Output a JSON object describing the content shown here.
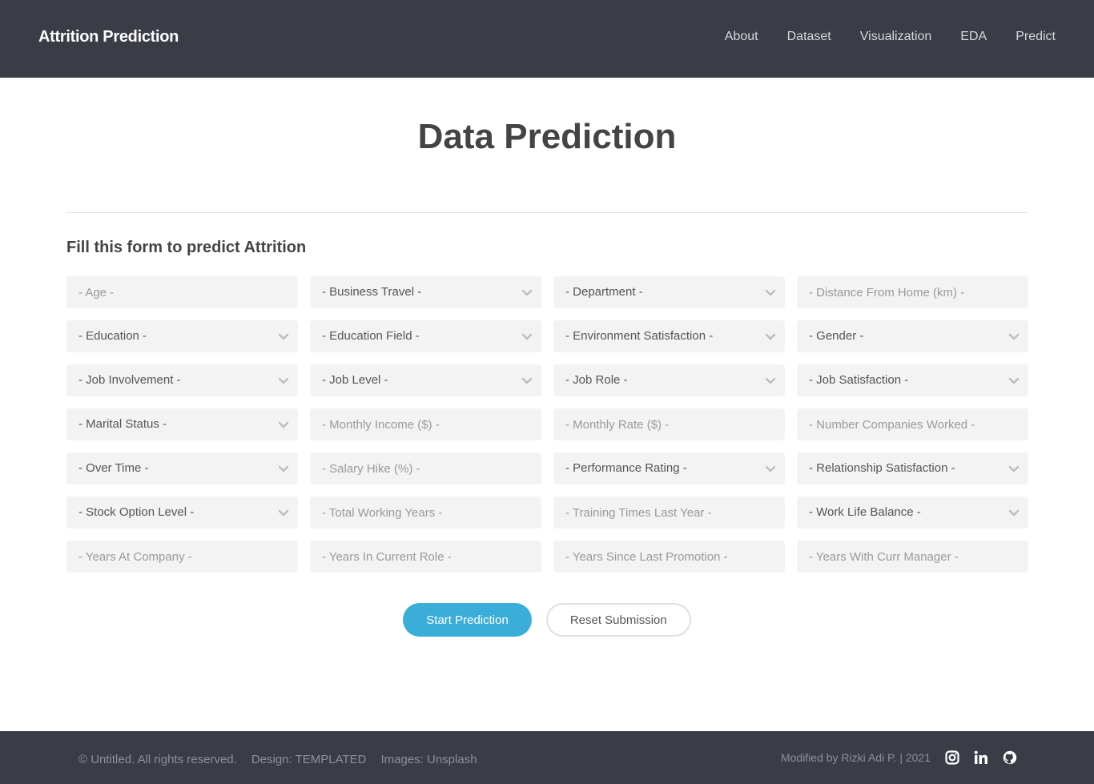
{
  "header": {
    "brand": "Attrition Prediction",
    "nav": [
      "About",
      "Dataset",
      "Visualization",
      "EDA",
      "Predict"
    ]
  },
  "main": {
    "title": "Data Prediction",
    "form_heading": "Fill this form to predict Attrition",
    "fields": [
      {
        "label": "- Age -",
        "kind": "input"
      },
      {
        "label": "- Business Travel -",
        "kind": "select"
      },
      {
        "label": "- Department -",
        "kind": "select"
      },
      {
        "label": "- Distance From Home (km) -",
        "kind": "input"
      },
      {
        "label": "- Education -",
        "kind": "select"
      },
      {
        "label": "- Education Field -",
        "kind": "select"
      },
      {
        "label": "- Environment Satisfaction -",
        "kind": "select"
      },
      {
        "label": "- Gender -",
        "kind": "select"
      },
      {
        "label": "- Job Involvement -",
        "kind": "select"
      },
      {
        "label": "- Job Level -",
        "kind": "select"
      },
      {
        "label": "- Job Role -",
        "kind": "select"
      },
      {
        "label": "- Job Satisfaction -",
        "kind": "select"
      },
      {
        "label": "- Marital Status -",
        "kind": "select"
      },
      {
        "label": "- Monthly Income ($) -",
        "kind": "input"
      },
      {
        "label": "- Monthly Rate ($) -",
        "kind": "input"
      },
      {
        "label": "- Number Companies Worked -",
        "kind": "input"
      },
      {
        "label": "- Over Time -",
        "kind": "select"
      },
      {
        "label": "- Salary Hike (%) -",
        "kind": "input"
      },
      {
        "label": "- Performance Rating -",
        "kind": "select"
      },
      {
        "label": "- Relationship Satisfaction -",
        "kind": "select"
      },
      {
        "label": "- Stock Option Level -",
        "kind": "select"
      },
      {
        "label": "- Total Working Years -",
        "kind": "input"
      },
      {
        "label": "- Training Times Last Year -",
        "kind": "input"
      },
      {
        "label": "- Work Life Balance -",
        "kind": "select"
      },
      {
        "label": "- Years At Company -",
        "kind": "input"
      },
      {
        "label": "- Years In Current Role -",
        "kind": "input"
      },
      {
        "label": "- Years Since Last Promotion -",
        "kind": "input"
      },
      {
        "label": "- Years With Curr Manager -",
        "kind": "input"
      }
    ],
    "buttons": {
      "submit": "Start Prediction",
      "reset": "Reset Submission"
    }
  },
  "footer": {
    "copyright": "© Untitled. All rights reserved.",
    "design": "Design: TEMPLATED",
    "images": "Images: Unsplash",
    "credit": "Modified by Rizki Adi P. | 2021",
    "social_icons": [
      "instagram-icon",
      "linkedin-icon",
      "github-icon"
    ]
  },
  "colors": {
    "header_bg": "#3a3d46",
    "accent": "#3aaed8",
    "field_bg": "#f3f3f3"
  }
}
